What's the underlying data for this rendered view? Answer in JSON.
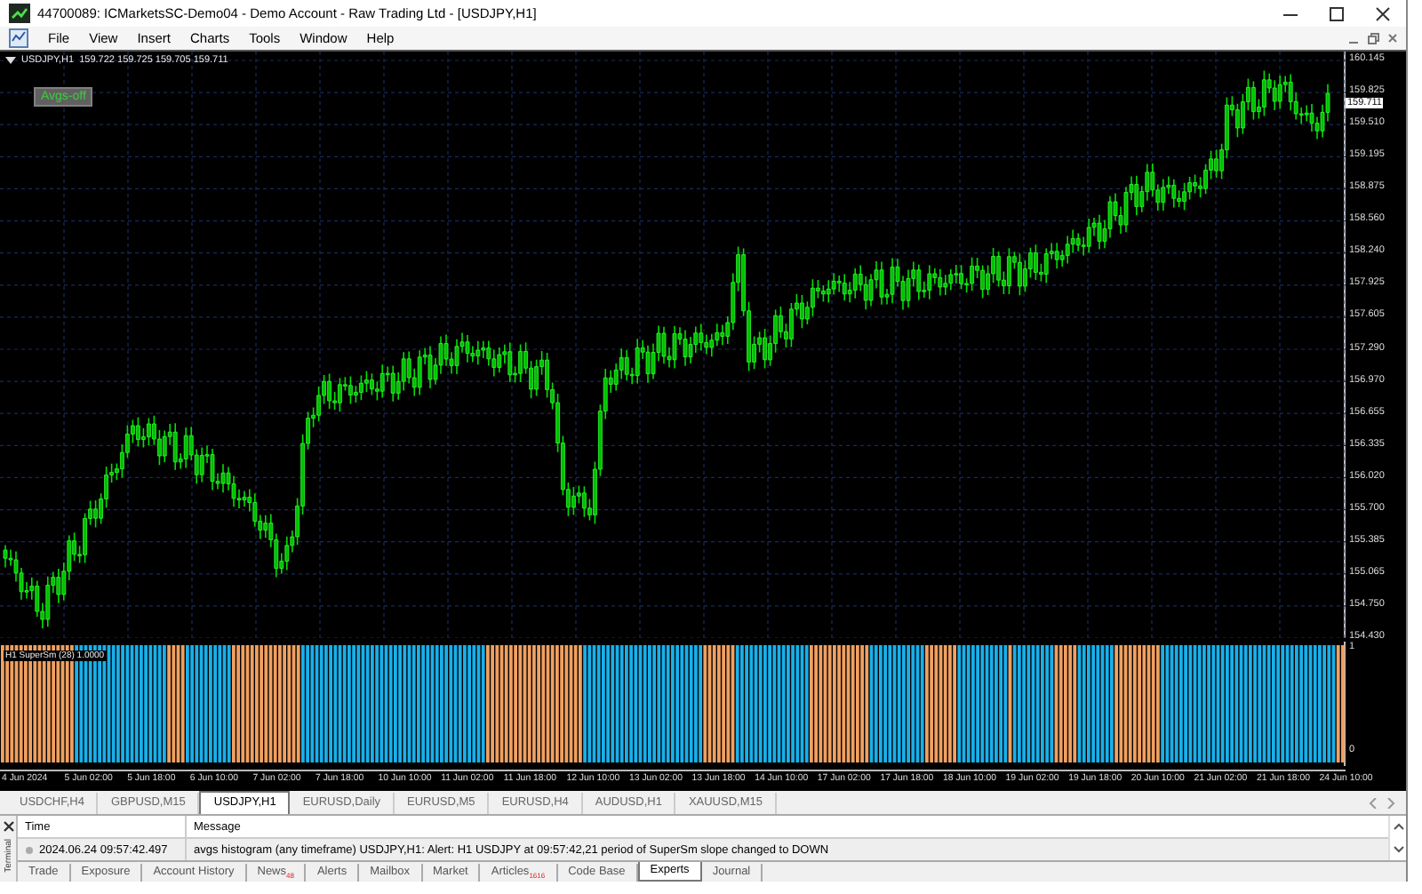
{
  "window": {
    "title": "44700089: ICMarketsSC-Demo04 - Demo Account - Raw Trading Ltd - [USDJPY,H1]"
  },
  "menu": [
    "File",
    "View",
    "Insert",
    "Charts",
    "Tools",
    "Window",
    "Help"
  ],
  "chart": {
    "header": "USDJPY,H1  159.722 159.725 159.705 159.711",
    "button": "Avgs-off",
    "price_axis": [
      "160.145",
      "159.825",
      "159.510",
      "159.195",
      "158.875",
      "158.560",
      "158.240",
      "157.925",
      "157.605",
      "157.290",
      "156.970",
      "156.655",
      "156.335",
      "156.020",
      "155.700",
      "155.385",
      "155.065",
      "154.750",
      "154.430"
    ],
    "current_price": "159.711",
    "indicator": {
      "label": "H1 SuperSm (28) 1.0000",
      "axis": [
        "1",
        "0"
      ]
    },
    "time_axis": [
      "4 Jun 2024",
      "5 Jun 02:00",
      "5 Jun 18:00",
      "6 Jun 10:00",
      "7 Jun 02:00",
      "7 Jun 18:00",
      "10 Jun 10:00",
      "11 Jun 02:00",
      "11 Jun 18:00",
      "12 Jun 10:00",
      "13 Jun 02:00",
      "13 Jun 18:00",
      "14 Jun 10:00",
      "17 Jun 02:00",
      "17 Jun 18:00",
      "18 Jun 10:00",
      "19 Jun 02:00",
      "19 Jun 18:00",
      "20 Jun 10:00",
      "21 Jun 02:00",
      "21 Jun 18:00",
      "24 Jun 10:00"
    ]
  },
  "chart_tabs": [
    {
      "label": "USDCHF,H4",
      "selected": false
    },
    {
      "label": "GBPUSD,M15",
      "selected": false
    },
    {
      "label": "USDJPY,H1",
      "selected": true
    },
    {
      "label": "EURUSD,Daily",
      "selected": false
    },
    {
      "label": "EURUSD,M5",
      "selected": false
    },
    {
      "label": "EURUSD,H4",
      "selected": false
    },
    {
      "label": "AUDUSD,H1",
      "selected": false
    },
    {
      "label": "XAUUSD,M15",
      "selected": false
    }
  ],
  "terminal": {
    "side_label": "Terminal",
    "columns": [
      "Time",
      "Message"
    ],
    "rows": [
      {
        "time": "2024.06.24 09:57:42.497",
        "message": "avgs histogram (any timeframe) USDJPY,H1: Alert: H1 USDJPY at 09:57:42,21 period of SuperSm slope changed to DOWN"
      }
    ],
    "tabs": [
      {
        "label": "Trade",
        "selected": false
      },
      {
        "label": "Exposure",
        "selected": false
      },
      {
        "label": "Account History",
        "selected": false
      },
      {
        "label": "News",
        "badge": "48",
        "selected": false
      },
      {
        "label": "Alerts",
        "selected": false
      },
      {
        "label": "Mailbox",
        "selected": false
      },
      {
        "label": "Market",
        "selected": false
      },
      {
        "label": "Articles",
        "badge": "1616",
        "selected": false
      },
      {
        "label": "Code Base",
        "selected": false
      },
      {
        "label": "Experts",
        "selected": true
      },
      {
        "label": "Journal",
        "selected": false
      }
    ]
  }
}
